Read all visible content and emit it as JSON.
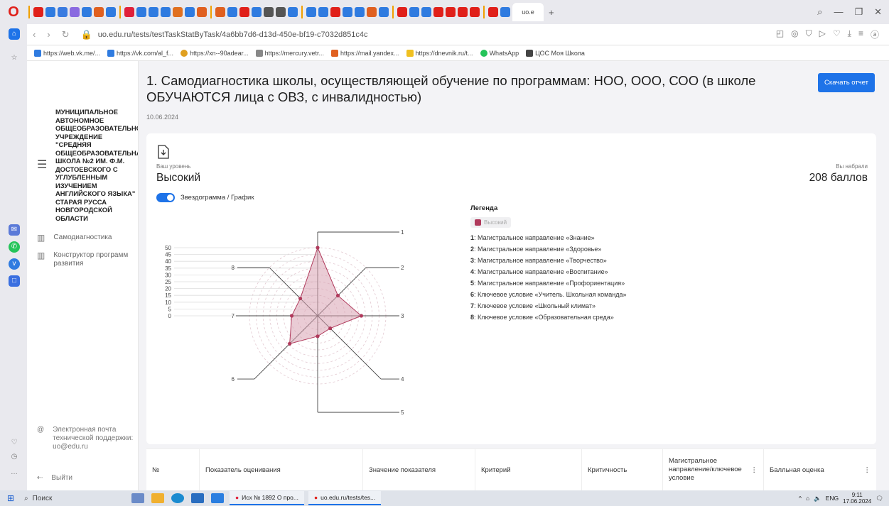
{
  "browser": {
    "url": "uo.edu.ru/tests/testTaskStatByTask/4a6bb7d6-d13d-450e-bf19-c7032d851c4c",
    "active_tab": "uo.e",
    "bookmarks": [
      "https://web.vk.me/...",
      "https://vk.com/al_f...",
      "https://xn--90adear...",
      "https://mercury.vetr...",
      "https://mail.yandex...",
      "https://dnevnik.ru/t...",
      "WhatsApp",
      "ЦОС Моя Школа"
    ]
  },
  "sidebar": {
    "school_name": "МУНИЦИПАЛЬНОЕ АВТОНОМНОЕ ОБЩЕОБРАЗОВАТЕЛЬНОЕ УЧРЕЖДЕНИЕ \"СРЕДНЯЯ ОБЩЕОБРАЗОВАТЕЛЬНАЯ ШКОЛА №2 ИМ. Ф.М. ДОСТОЕВСКОГО С УГЛУБЛЕННЫМ ИЗУЧЕНИЕМ АНГЛИЙСКОГО ЯЗЫКА\" СТАРАЯ РУССА НОВГОРОДСКОЙ ОБЛАСТИ",
    "nav": [
      "Самодиагностика",
      "Конструктор программ развития"
    ],
    "support": "Электронная почта технической поддержки: uo@edu.ru",
    "logout": "Выйти"
  },
  "page": {
    "title": "1. Самодиагностика школы, осуществляющей обучение по программам: НОО, ООО, СОО (в школе ОБУЧАЮТСЯ лица с ОВЗ, с инвалидностью)",
    "date": "10.06.2024",
    "download_label": "Скачать отчет",
    "level_label": "Ваш уровень",
    "level_value": "Высокий",
    "score_label": "Вы набрали",
    "score_value": "208 баллов",
    "toggle_label": "Звездограмма / График"
  },
  "chart_data": {
    "type": "radar",
    "axes": [
      "1",
      "2",
      "3",
      "4",
      "5",
      "6",
      "7",
      "8"
    ],
    "axis_names": [
      "Магистральное направление «Знание»",
      "Магистральное направление «Здоровье»",
      "Магистральное направление «Творчество»",
      "Магистральное направление «Воспитание»",
      "Магистральное направление «Профориентация»",
      "Ключевое условие «Учитель. Школьная команда»",
      "Ключевое условие «Школьный климат»",
      "Ключевое условие «Образовательная среда»"
    ],
    "series": [
      {
        "name": "Высокий",
        "values": [
          50,
          21,
          32,
          13,
          15,
          29,
          19,
          18
        ]
      }
    ],
    "rlim": [
      0,
      50
    ],
    "ticks": [
      0,
      5,
      10,
      15,
      20,
      25,
      30,
      35,
      40,
      45,
      50
    ],
    "legend_title": "Легенда",
    "colors": {
      "fill": "#d9a3b3",
      "stroke": "#b03a5c",
      "point": "#b03a5c"
    }
  },
  "table": {
    "headers": [
      "№",
      "Показатель оценивания",
      "Значение показателя",
      "Критерий",
      "Критичность",
      "Магистральное направление/ключевое условие",
      "Балльная оценка"
    ]
  },
  "taskbar": {
    "search": "Поиск",
    "tasks": [
      "Исх № 1892 О про...",
      "uo.edu.ru/tests/tes..."
    ],
    "lang": "ENG",
    "time": "9:11",
    "date": "17.06.2024"
  }
}
